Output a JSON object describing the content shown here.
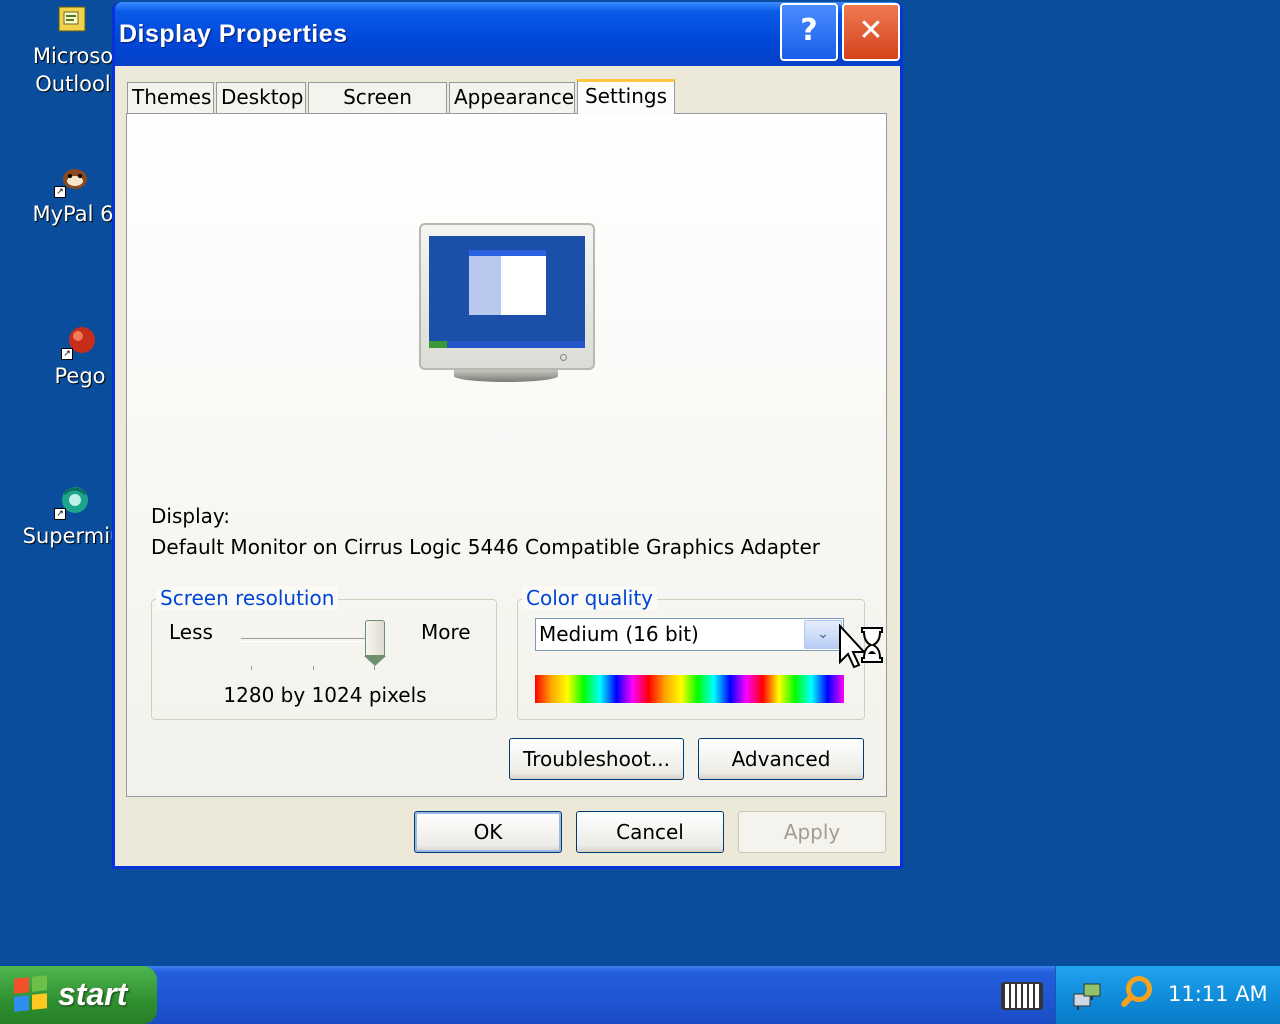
{
  "desktop": {
    "icons": [
      {
        "label": "Microso\nOutlool",
        "icon": "outlook-icon"
      },
      {
        "label": "MyPal 6",
        "icon": "mypal-icon"
      },
      {
        "label": "Pego",
        "icon": "pego-icon"
      },
      {
        "label": "Supermiu",
        "icon": "supermium-icon"
      }
    ]
  },
  "window": {
    "title": "Display Properties",
    "help_label": "?",
    "close_label": "✕",
    "tabs": [
      {
        "label": "Themes",
        "active": false
      },
      {
        "label": "Desktop",
        "active": false
      },
      {
        "label": "Screen Saver",
        "active": false
      },
      {
        "label": "Appearance",
        "active": false
      },
      {
        "label": "Settings",
        "active": true
      }
    ],
    "settings": {
      "display_label": "Display:",
      "display_value": "Default Monitor on Cirrus Logic 5446 Compatible Graphics Adapter",
      "resolution": {
        "legend": "Screen resolution",
        "less_label": "Less",
        "more_label": "More",
        "value_text": "1280 by 1024 pixels",
        "slider_level": 1.0
      },
      "color_quality": {
        "legend": "Color quality",
        "selected": "Medium (16 bit)",
        "dropdown_glyph": "⌄"
      },
      "troubleshoot_label": "Troubleshoot...",
      "advanced_label": "Advanced"
    },
    "ok_label": "OK",
    "cancel_label": "Cancel",
    "apply_label": "Apply"
  },
  "taskbar": {
    "start_label": "start",
    "clock": "11:11 AM",
    "tray_icons": [
      "keyboard-icon",
      "network-icon",
      "search-icon"
    ]
  },
  "colors": {
    "desktop_bg": "#0a4d9c",
    "title_bar": "#0a5be8",
    "close_button": "#d4431c",
    "legend_text": "#0046d5",
    "start_button": "#2f902f"
  }
}
